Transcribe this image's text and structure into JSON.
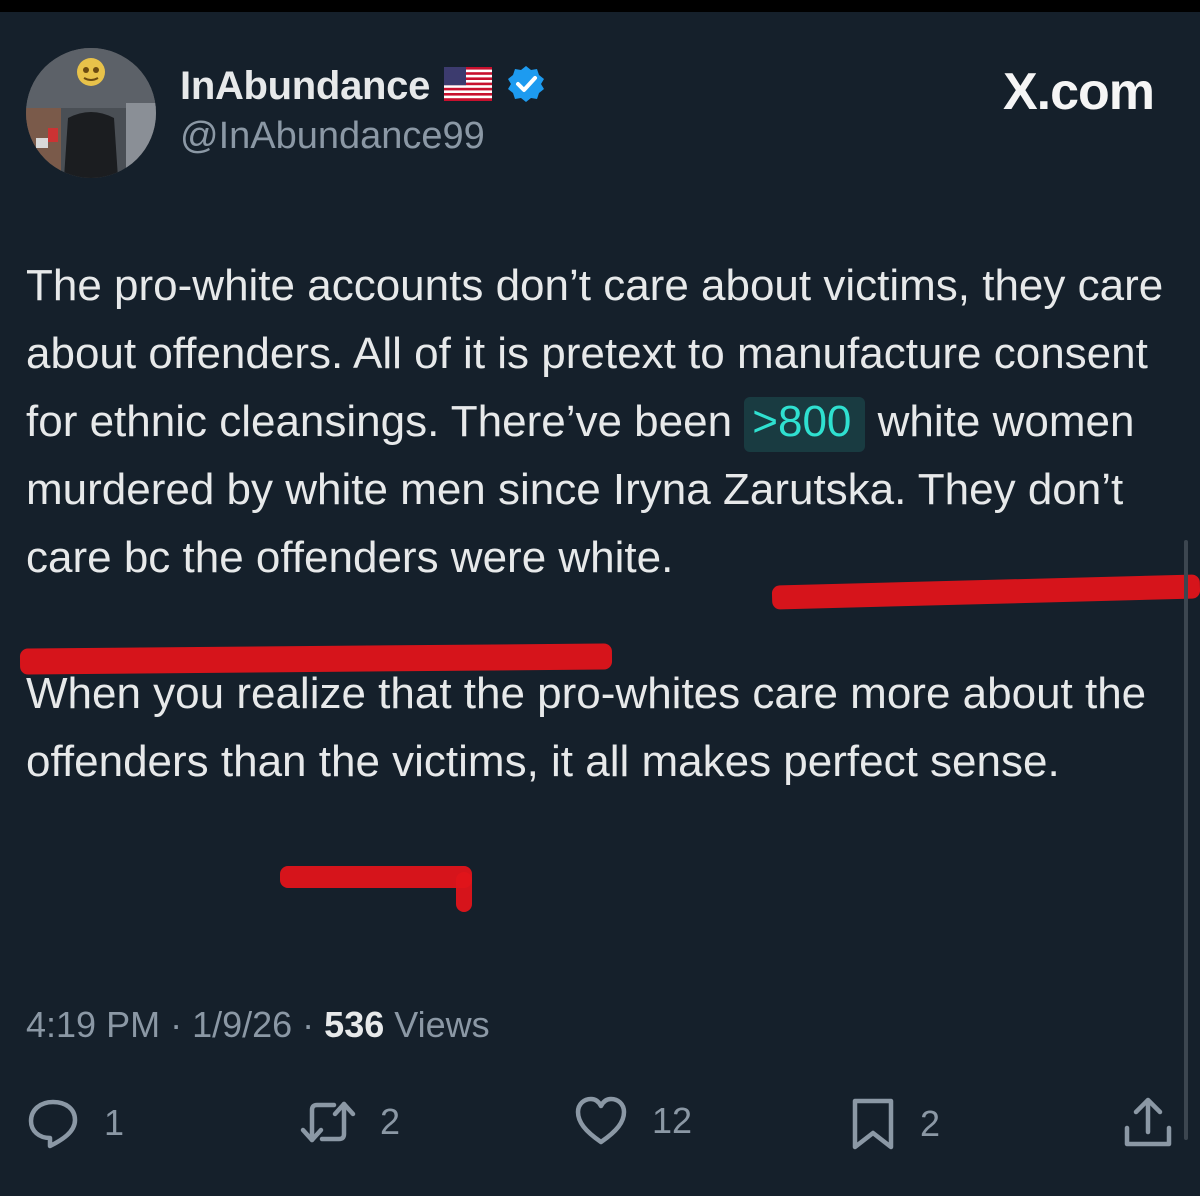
{
  "post": {
    "display_name": "InAbundance",
    "handle": "@InAbundance99",
    "brand": "X.com",
    "text_line1_before": "The pro-white accounts don’t care about victims, they care about offenders. All of it is pretext to manufacture consent for ethnic cleansings. There’ve been ",
    "text_link": ">800",
    "text_line1_after": " white women murdered by white men since Iryna Zarutska. They don’t care bc the offenders were white.",
    "text_paragraph2": "When you realize that the pro-whites care more about the offenders than the victims, it all makes perfect sense.",
    "time": "4:19 PM",
    "separator": " · ",
    "date": "1/9/26",
    "views_count": "536",
    "views_label": " Views"
  },
  "actions": {
    "replies": "1",
    "reposts": "2",
    "likes": "12",
    "bookmarks": "2"
  },
  "icons": {
    "flag": "us-flag-icon",
    "verified": "verified-badge-icon",
    "reply": "reply-icon",
    "repost": "repost-icon",
    "like": "heart-icon",
    "bookmark": "bookmark-icon",
    "share": "share-icon"
  },
  "colors": {
    "background": "#15202b",
    "verified": "#1d9bf0",
    "link": "#2fe0d0",
    "annotation": "#e0141a"
  }
}
